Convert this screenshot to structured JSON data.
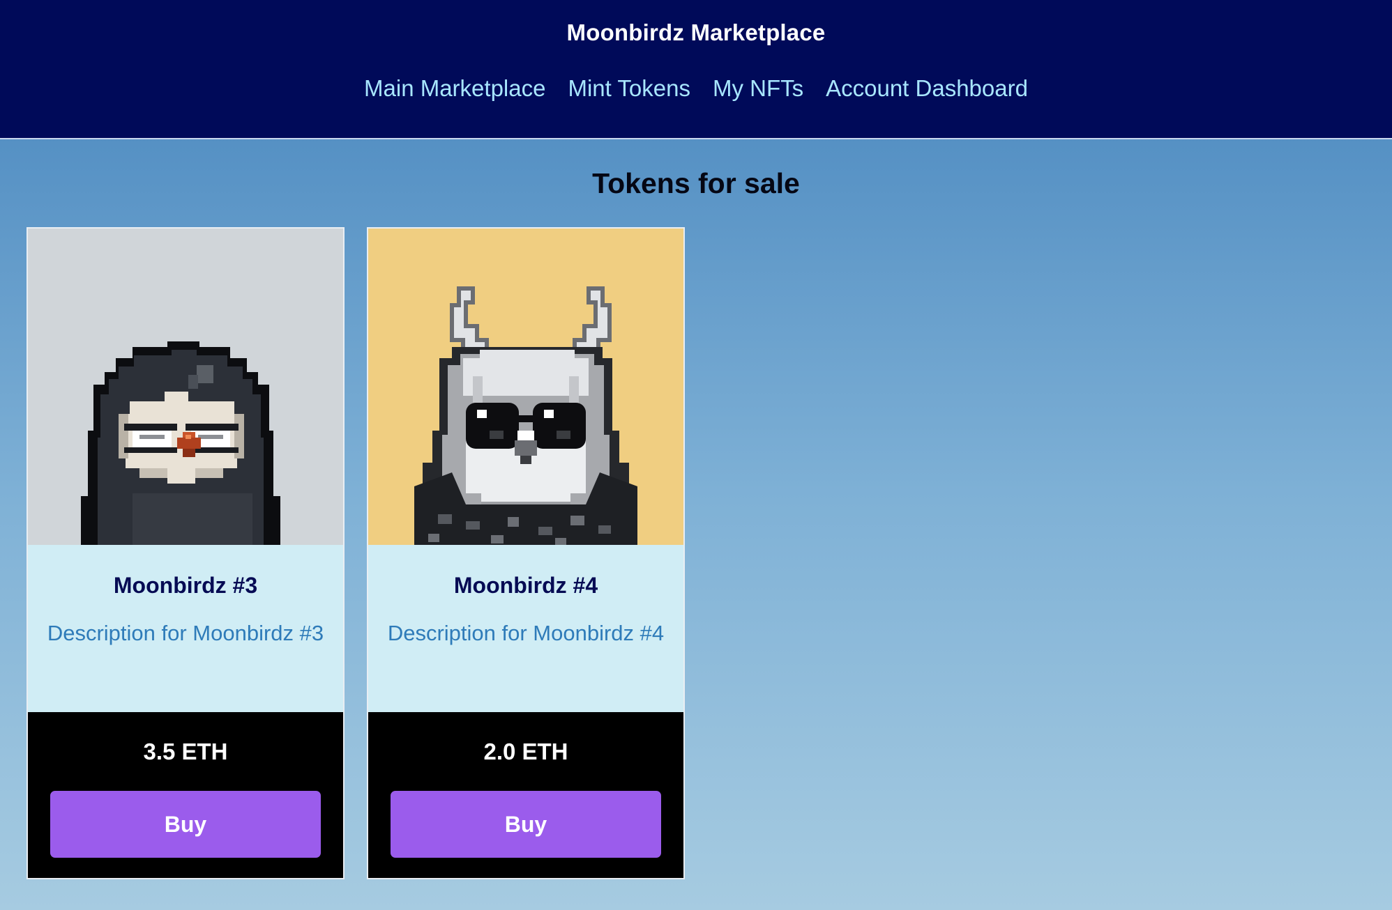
{
  "header": {
    "brand": "Moonbirdz Marketplace",
    "nav": [
      "Main Marketplace",
      "Mint Tokens",
      "My NFTs",
      "Account Dashboard"
    ]
  },
  "main": {
    "title": "Tokens for sale",
    "cards": [
      {
        "name": "Moonbirdz #3",
        "description": "Description for Moonbirdz #3",
        "price": "3.5 ETH",
        "buy_label": "Buy",
        "image_background": "#d0d5d9",
        "image": "moonbird-penguin-pixel-art"
      },
      {
        "name": "Moonbirdz #4",
        "description": "Description for Moonbirdz #4",
        "price": "2.0 ETH",
        "buy_label": "Buy",
        "image_background": "#f0ce81",
        "image": "moonbird-owl-sunglasses-pixel-art"
      }
    ]
  },
  "colors": {
    "navbar": "#000a59",
    "nav_link": "#a8e6ff",
    "card_body": "#d0edf5",
    "card_footer": "#000000",
    "buy_button": "#9b5cec",
    "name_text": "#060b54",
    "description_text": "#2e7bb9"
  }
}
